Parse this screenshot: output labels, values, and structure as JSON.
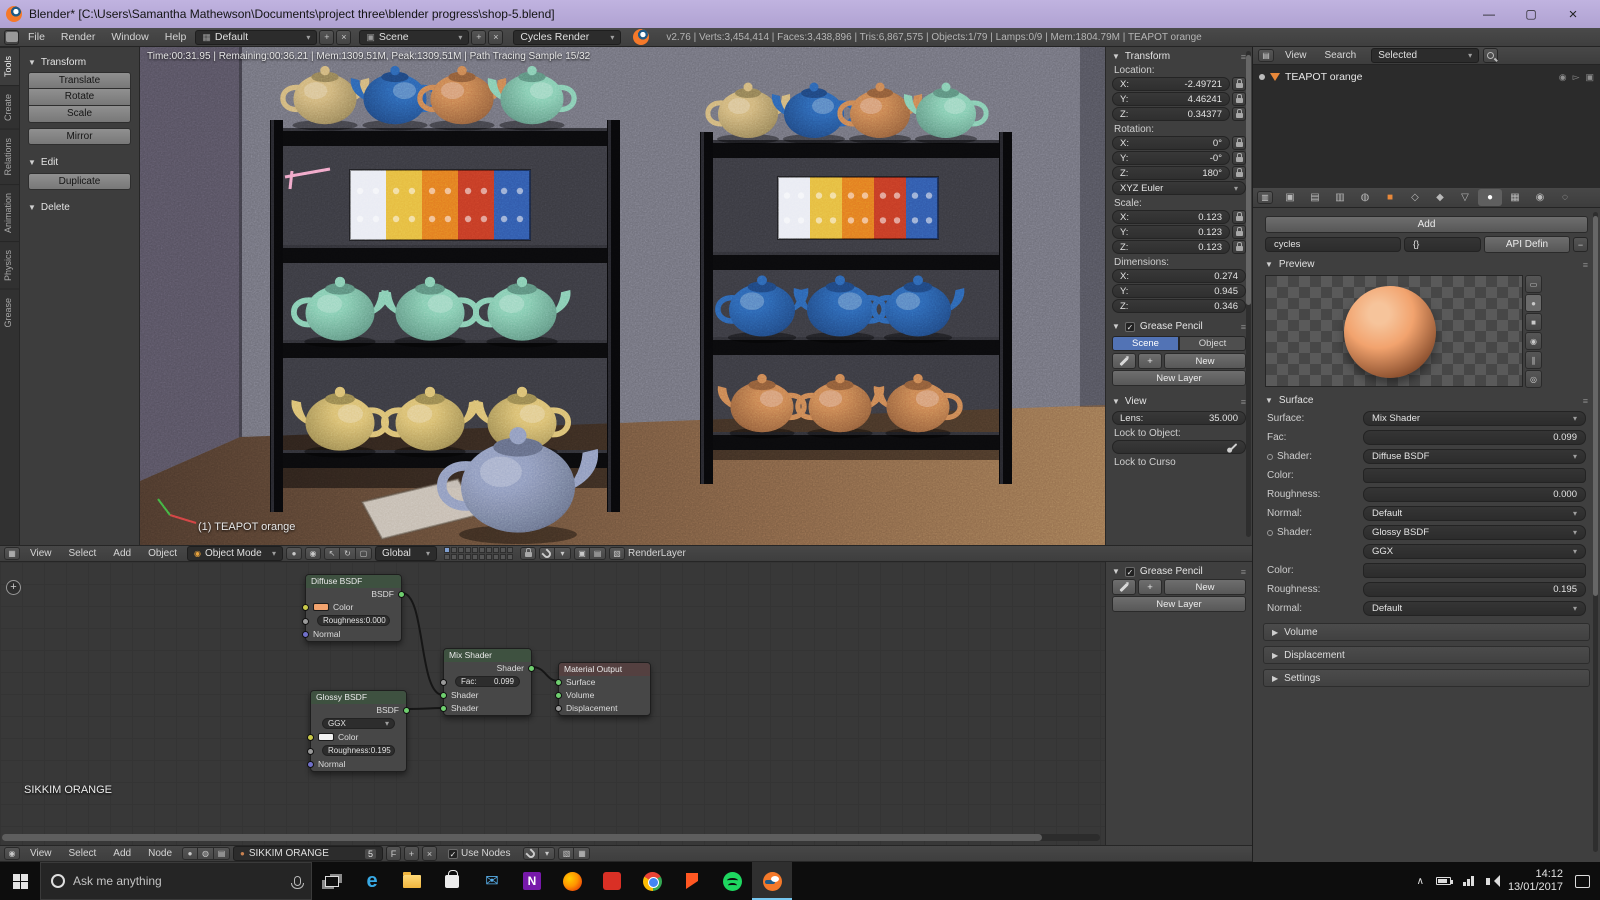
{
  "icons": {
    "minimize": "—",
    "maximize": "▢",
    "close": "×",
    "collapse": "▼",
    "expand": "▶",
    "dropdown": "▾",
    "plus": "+",
    "minus": "−",
    "check": "✓",
    "grip": "≡",
    "x": "×"
  },
  "glyphs": {
    "editor_3d": "▦",
    "editor_node": "◉",
    "editor_outliner": "▤",
    "editor_props": "▥",
    "screen_icon": "▦",
    "scene_icon": "▣",
    "prop_tabs": [
      "▣",
      "▤",
      "▥",
      "◍",
      "■",
      "◇",
      "◆",
      "▽",
      "●",
      "▦",
      "◉",
      "◌"
    ],
    "preview_modes": [
      "▭",
      "●",
      "■",
      "◉",
      "∥",
      "◎"
    ],
    "v3d_shading": "●",
    "v3d_pivot": "◉",
    "v3d_manip": [
      "↖",
      "↻",
      "▢"
    ],
    "v3d_cam": "▣",
    "v3d_sheet": "▤",
    "v3d_rl": "▧",
    "node_ctx": [
      "●",
      "◍",
      "▤"
    ],
    "node_right": [
      "▧",
      "▦"
    ],
    "mat_icon": "●",
    "edge_letter": "e",
    "onenote_letter": "N",
    "mail_icon": "✉"
  },
  "titlebar": {
    "title": "Blender* [C:\\Users\\Samantha Mathewson\\Documents\\project three\\blender progress\\shop-5.blend]"
  },
  "infobar": {
    "menus": [
      "File",
      "Render",
      "Window",
      "Help"
    ],
    "layout": "Default",
    "scene": "Scene",
    "engine": "Cycles Render",
    "stats": "v2.76 | Verts:3,454,414 | Faces:3,438,896 | Tris:6,867,575 | Objects:1/79 | Lamps:0/9 | Mem:1804.79M | TEAPOT orange"
  },
  "toolshelf": {
    "tabs": [
      "Tools",
      "Create",
      "Relations",
      "Animation",
      "Physics",
      "Grease"
    ],
    "transform_title": "Transform",
    "translate": "Translate",
    "rotate": "Rotate",
    "scale": "Scale",
    "mirror": "Mirror",
    "edit_title": "Edit",
    "duplicate": "Duplicate",
    "delete_title": "Delete"
  },
  "viewport": {
    "render_stats": "Time:00:31.95 | Remaining:00:36.21 | Mem:1309.51M, Peak:1309.51M | Path Tracing Sample 15/32",
    "active_object": "(1) TEAPOT orange"
  },
  "npanel": {
    "transform_title": "Transform",
    "location_label": "Location:",
    "loc": [
      {
        "a": "X:",
        "v": "-2.49721"
      },
      {
        "a": "Y:",
        "v": "4.46241"
      },
      {
        "a": "Z:",
        "v": "0.34377"
      }
    ],
    "rotation_label": "Rotation:",
    "rot": [
      {
        "a": "X:",
        "v": "0°"
      },
      {
        "a": "Y:",
        "v": "-0°"
      },
      {
        "a": "Z:",
        "v": "180°"
      }
    ],
    "rot_mode": "XYZ Euler",
    "scale_label": "Scale:",
    "scl": [
      {
        "a": "X:",
        "v": "0.123"
      },
      {
        "a": "Y:",
        "v": "0.123"
      },
      {
        "a": "Z:",
        "v": "0.123"
      }
    ],
    "dim_label": "Dimensions:",
    "dim": [
      {
        "a": "X:",
        "v": "0.274"
      },
      {
        "a": "Y:",
        "v": "0.945"
      },
      {
        "a": "Z:",
        "v": "0.346"
      }
    ],
    "gp_title": "Grease Pencil",
    "gp_scene": "Scene",
    "gp_object": "Object",
    "gp_new": "New",
    "gp_new_layer": "New Layer",
    "view_title": "View",
    "lens_label": "Lens:",
    "lens_value": "35.000",
    "lock_obj_label": "Lock to Object:",
    "lock_cursor_label": "Lock to Curso"
  },
  "outliner": {
    "view": "View",
    "search": "Search",
    "filter": "Selected",
    "item": "TEAPOT orange"
  },
  "properties": {
    "add_button": "Add",
    "prop_name": "cycles",
    "prop_value": "{}",
    "prop_api": "API Defin",
    "preview_title": "Preview",
    "surface_title": "Surface",
    "surface_label": "Surface:",
    "surface_value": "Mix Shader",
    "fac_label": "Fac:",
    "fac_value": "0.099",
    "shader_label": "Shader:",
    "shader1_value": "Diffuse BSDF",
    "color_label": "Color:",
    "roughness_label": "Roughness:",
    "rough1_value": "0.000",
    "normal_label": "Normal:",
    "normal_value": "Default",
    "shader2_value": "Glossy BSDF",
    "ggx_value": "GGX",
    "rough2_value": "0.195",
    "volume_title": "Volume",
    "displacement_title": "Displacement",
    "settings_title": "Settings",
    "diffuse_color": "#f2a36e",
    "glossy_color": "#f2f2f2"
  },
  "v3d": {
    "menus": [
      "View",
      "Select",
      "Add",
      "Object"
    ],
    "mode": "Object Mode",
    "orientation": "Global",
    "render_layer": "RenderLayer"
  },
  "nodes": {
    "label": "SIKKIM ORANGE",
    "diffuse": {
      "title": "Diffuse BSDF",
      "out": "BSDF",
      "color": "Color",
      "rough_label": "Roughness:",
      "rough": "0.000",
      "normal": "Normal"
    },
    "glossy": {
      "title": "Glossy BSDF",
      "out": "BSDF",
      "dist": "GGX",
      "color": "Color",
      "rough_label": "Roughness:",
      "rough": "0.195",
      "normal": "Normal"
    },
    "mix": {
      "title": "Mix Shader",
      "out": "Shader",
      "fac_label": "Fac:",
      "fac": "0.099",
      "in1": "Shader",
      "in2": "Shader"
    },
    "output": {
      "title": "Material Output",
      "surface": "Surface",
      "volume": "Volume",
      "displacement": "Displacement"
    },
    "gp_title": "Grease Pencil",
    "gp_new": "New",
    "gp_new_layer": "New Layer"
  },
  "nheader": {
    "menus": [
      "View",
      "Select",
      "Add",
      "Node"
    ],
    "name": "SIKKIM ORANGE",
    "users": "5",
    "fake": "F",
    "use_nodes": "Use Nodes"
  },
  "taskbar": {
    "search": "Ask me anything",
    "time": "14:12",
    "date": "13/01/2017"
  },
  "scene": {
    "wall": "#6f6f7a",
    "wall_left": "#55505f",
    "corner": "#3e3c46",
    "floor_dark": "#4a372b",
    "floor_light": "#9a7350",
    "floor_teapot": "#8d99bd",
    "cloth": "#cfc8be",
    "grease": "#f0a3c6",
    "fabric": [
      "#e9ebf3",
      "#e5ba3f",
      "#e27a20",
      "#c33a24",
      "#3058a9"
    ],
    "rows": {
      "left_top": [
        "#cfb378",
        "#2b62b0",
        "#c98150",
        "#82cbb0"
      ],
      "left_mid": [
        "#82cbb0",
        "#82cbb0",
        "#82cbb0"
      ],
      "left_bot": [
        "#d9bd6f",
        "#d9bd6f",
        "#d9bd6f"
      ],
      "right_top": [
        "#cfb378",
        "#2b62b0",
        "#c98150",
        "#82cbb0"
      ],
      "right_mid": [
        "#2b62b0",
        "#2b62b0",
        "#2b62b0"
      ],
      "right_bot": [
        "#c98150",
        "#c98150",
        "#c98150"
      ]
    }
  }
}
